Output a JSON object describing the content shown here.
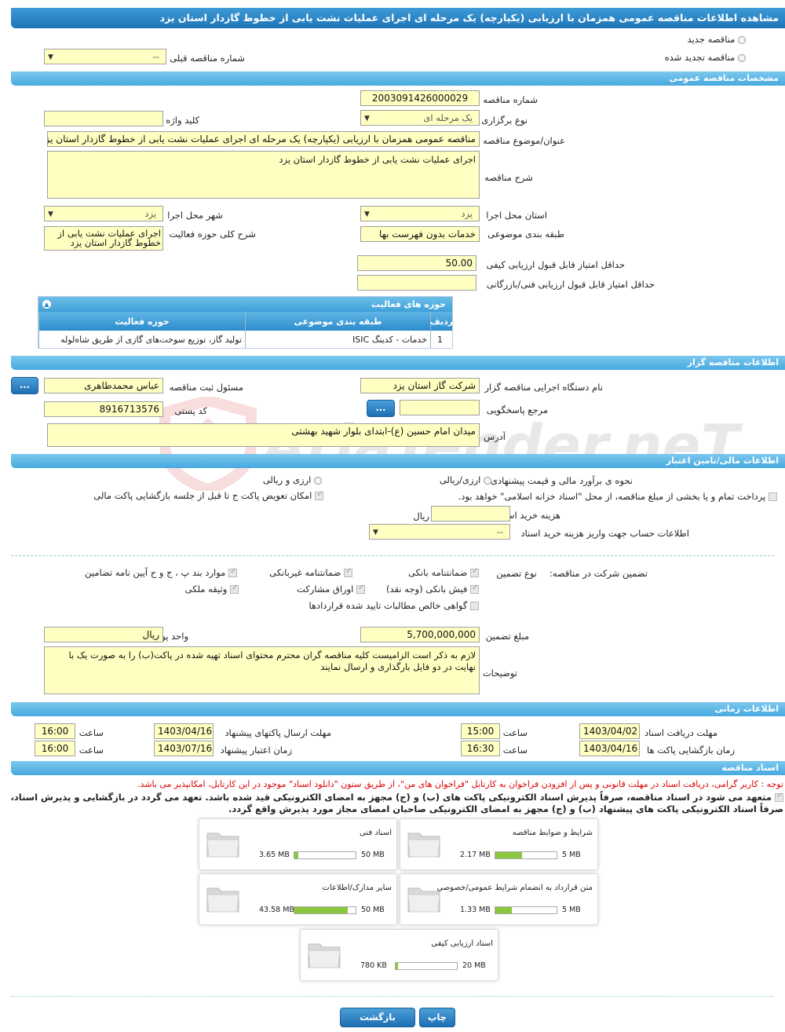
{
  "page_title": "مشاهده اطلاعات مناقصه عمومی همزمان با ارزیابی (یکپارچه) یک مرحله ای اجرای عملیات نشت یابی از خطوط گازدار استان یزد",
  "tender_type": {
    "new": "مناقصه جدید",
    "renewed": "مناقصه تجدید شده",
    "prev_label": "شماره مناقصه قبلی",
    "prev_value": "--"
  },
  "sections": {
    "general": "مشخصات مناقصه عمومی",
    "organizer": "اطلاعات مناقصه گزار",
    "financial": "اطلاعات مالی/تامین اعتبار",
    "timing": "اطلاعات زمانی",
    "documents": "اسناد مناقصه"
  },
  "general": {
    "number_label": "شماره مناقصه",
    "number": "2003091426000029",
    "holding_label": "نوع برگزاری",
    "holding": "یک مرحله ای",
    "keyword_label": "کلید واژه",
    "keyword": "",
    "subject_label": "عنوان/موضوع مناقصه",
    "subject": "مناقصه عمومی همزمان با ارزیابی (یکپارچه) یک مرحله ای اجرای عملیات نشت یابی از خطوط گازدار استان یزد",
    "desc_label": "شرح مناقصه",
    "desc": "اجرای عملیات نشت یابی از خطوط گازدار استان یزد",
    "province_label": "استان محل اجرا",
    "province": "یزد",
    "city_label": "شهر محل اجرا",
    "city": "یزد",
    "category_label": "طبقه بندی موضوعی",
    "category": "خدمات بدون فهرست بها",
    "activity_label": "شرح کلی حوزه فعالیت",
    "activity": "اجرای عملیات نشت یابی از خطوط گازدار استان یزد",
    "min_quality_label": "حداقل امتیاز قابل قبول ارزیابی کیفی",
    "min_quality": "50.00",
    "min_tech_label": "حداقل امتیاز قابل قبول ارزیابی فنی/بازرگانی",
    "min_tech": ""
  },
  "activity_table": {
    "title": "حوزه های فعالیت",
    "headers": [
      "ردیف",
      "طبقه بندی موضوعی",
      "حوزه فعالیت"
    ],
    "rows": [
      [
        "1",
        "خدمات - کدینگ ISIC",
        "تولید گاز، توزیع سوخت‌های گازی از طریق شاه‌لوله"
      ]
    ]
  },
  "organizer": {
    "org_label": "نام دستگاه اجرایی مناقصه گزار",
    "org": "شرکت گاز استان یزد",
    "resp_label": "مسئول ثبت مناقصه",
    "resp": "عباس محمدطاهری",
    "ref_label": "مرجع پاسخگویی",
    "ref": "",
    "postal_label": "کد پستی",
    "postal": "8916713576",
    "address_label": "آدرس",
    "address": "میدان امام حسین (ع)-ابتدای بلوار شهید بهشتی",
    "dots": "..."
  },
  "financial": {
    "estimate_label": "نحوه ی برآورد مالی و قیمت پیشنهادی",
    "opt1": "ارزی/ریالی",
    "opt2": "ارزی و ریالی",
    "swap_label": "امکان تعویض پاکت ج تا قبل از جلسه بازگشایی پاکت مالی",
    "treasury_label": "پرداخت تمام و یا بخشی از مبلغ مناقصه، از محل \"اسناد خزانه اسلامی\" خواهد بود.",
    "doc_cost_label": "هزینه خرید اسناد",
    "doc_cost": "",
    "rial": "ریال",
    "account_label": "اطلاعات حساب جهت واریز هزینه خرید اسناد",
    "account": "--",
    "guarantee_label": "تضمین شرکت در مناقصه:",
    "guarantee_type_label": "نوع تضمین",
    "g1": "ضمانتنامه بانکی",
    "g2": "ضمانتنامه غیربانکی",
    "g3": "موارد بند پ ، ج و ح آیین نامه تضامین",
    "g4": "فیش بانکی (وجه نقد)",
    "g5": "اوراق مشارکت",
    "g6": "وثیقه ملکی",
    "g7": "گواهی خالص مطالبات تایید شده قراردادها",
    "amount_label": "مبلغ تضمین",
    "amount": "5,700,000,000",
    "currency_label": "واحد پول",
    "currency": "ریال",
    "notes_label": "توضیحات",
    "notes": "لازم به ذکر است  الزامیست کلیه مناقصه گران  محترم محتوای اسناد تهیه شده در پاکت(ب) را به صورت یک  با نهایت در دو فایل بارگذاری و ارسال نمایند"
  },
  "timing": {
    "receive_label": "مهلت دریافت اسناد",
    "receive_date": "1403/04/02",
    "receive_time": "15:00",
    "submit_label": "مهلت ارسال پاکتهای پیشنهاد",
    "submit_date": "1403/04/16",
    "submit_time": "16:00",
    "open_label": "زمان بازگشایی پاکت ها",
    "open_date": "1403/04/16",
    "open_time": "16:30",
    "valid_label": "زمان اعتبار پیشنهاد",
    "valid_date": "1403/07/16",
    "valid_time": "16:00",
    "time_label": "ساعت"
  },
  "documents": {
    "note1": "توجه : کاربر گرامی، دریافت اسناد در مهلت قانونی و پس از افزودن فراخوان به کارتابل \"فراخوان های من\"، از طریق ستون \"دانلود اسناد\" موجود در این کارتابل، امکانپذیر می باشد.",
    "note2": "متعهد می شود در اسناد مناقصه، صرفاً پذیرش اسناد الکترونیکی پاکت های (ب) و (ج) مجهز به امضای الکترونیکی قید شده باشد. تعهد می گردد در بازگشایی و پذیرش اسناد،",
    "note3": "صرفاً اسناد الکترونیکی پاکت های پیشنهاد (ب) و (ج) مجهز به امضای الکترونیکی صاحبان امضای مجاز مورد پذیرش واقع گردد.",
    "files": [
      {
        "name": "شرایط و ضوابط مناقصه",
        "size": "2.17 MB",
        "max": "5 MB",
        "fill": 0.43
      },
      {
        "name": "اسناد فنی",
        "size": "3.65 MB",
        "max": "50 MB",
        "fill": 0.07
      },
      {
        "name": "متن قرارداد به انضمام شرایط عمومی/خصوصی",
        "size": "1.33 MB",
        "max": "5 MB",
        "fill": 0.27
      },
      {
        "name": "سایر مدارک/اطلاعات",
        "size": "43.58 MB",
        "max": "50 MB",
        "fill": 0.87
      },
      {
        "name": "اسناد ارزیابی کیفی",
        "size": "780 KB",
        "max": "20 MB",
        "fill": 0.04
      }
    ]
  },
  "buttons": {
    "print": "چاپ",
    "back": "بازگشت"
  },
  "watermark": "AriaTender.neT"
}
